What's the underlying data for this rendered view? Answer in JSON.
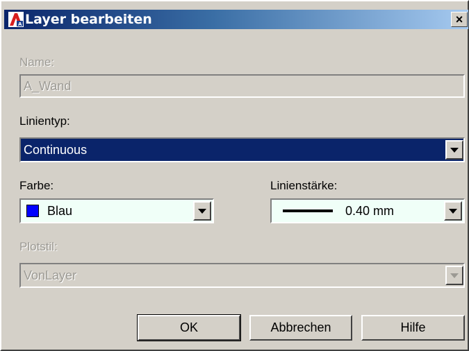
{
  "window": {
    "title": "Layer bearbeiten",
    "close_label": "×"
  },
  "fields": {
    "name": {
      "label": "Name:",
      "value": "A_Wand",
      "disabled": true
    },
    "linetype": {
      "label": "Linientyp:",
      "value": "Continuous",
      "selected": true
    },
    "color": {
      "label": "Farbe:",
      "value": "Blau",
      "swatch_color": "#0000ff"
    },
    "lineweight": {
      "label": "Linienstärke:",
      "value": "0.40 mm"
    },
    "plotstyle": {
      "label": "Plotstil:",
      "value": "VonLayer",
      "disabled": true
    }
  },
  "buttons": {
    "ok": "OK",
    "cancel": "Abbrechen",
    "help": "Hilfe"
  },
  "colors": {
    "selection_bg": "#0a246a",
    "dropdown_bg": "#f0fff8",
    "disabled_text": "#9c9a94",
    "title_gradient_start": "#0a246a",
    "title_gradient_end": "#a6caf0"
  },
  "icons": {
    "app": "autocad-icon",
    "close": "close-icon",
    "dropdown": "chevron-down-icon"
  }
}
